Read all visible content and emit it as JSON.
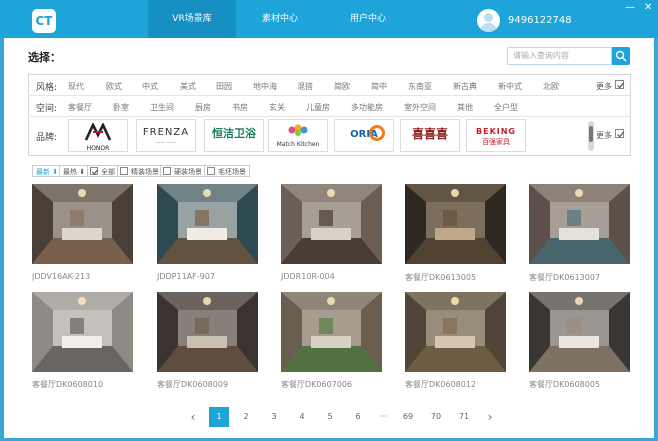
{
  "header": {
    "logo": "CT",
    "nav": [
      {
        "label": "VR场景库",
        "active": true
      },
      {
        "label": "素材中心",
        "active": false
      },
      {
        "label": "用户中心",
        "active": false
      }
    ],
    "phone": "9496122748",
    "window_controls": {
      "minimize": "—",
      "close": "✕"
    }
  },
  "selection": {
    "title": "选择：",
    "search_placeholder": "请输入查询内容",
    "more_label": "更多"
  },
  "filters": {
    "style": {
      "label": "风格:",
      "items": [
        "现代",
        "欧式",
        "中式",
        "美式",
        "田园",
        "地中海",
        "混搭",
        "简欧",
        "简中",
        "东南亚",
        "新古典",
        "新中式",
        "北欧"
      ]
    },
    "space": {
      "label": "空间:",
      "items": [
        "客餐厅",
        "卧室",
        "卫生间",
        "厨房",
        "书房",
        "玄关",
        "儿童房",
        "多功能房",
        "室外空间",
        "其他",
        "全户型"
      ]
    },
    "brand": {
      "label": "品牌:",
      "items": [
        {
          "name": "HONOR"
        },
        {
          "name": "FRENZA"
        },
        {
          "name": "恒洁卫浴"
        },
        {
          "name": "Match Kitchen"
        },
        {
          "name": "ORIA"
        },
        {
          "name": "喜喜喜"
        },
        {
          "name": "BEKING"
        }
      ]
    }
  },
  "toolbar": {
    "sort_latest": "最新 ⬇",
    "sort_hot": "最热 ⬇",
    "types": [
      {
        "label": "全部",
        "checked": true
      },
      {
        "label": "精装场景",
        "checked": false
      },
      {
        "label": "硬装场景",
        "checked": false
      },
      {
        "label": "毛坯场景",
        "checked": false
      }
    ]
  },
  "scenes": [
    {
      "title": "JDDV16AK-213",
      "palette": [
        "#4a4038",
        "#dcd6cc",
        "#8b6d55"
      ]
    },
    {
      "title": "JDDP11AF-907",
      "palette": [
        "#2d4a52",
        "#f0ebe4",
        "#7a5638"
      ]
    },
    {
      "title": "JDDR10R-004",
      "palette": [
        "#6b5f55",
        "#d9d2c8",
        "#3a2f28"
      ]
    },
    {
      "title": "客餐厅DK0613005",
      "palette": [
        "#2e2823",
        "#bfa88a",
        "#604b38"
      ]
    },
    {
      "title": "客餐厅DK0613007",
      "palette": [
        "#5c5048",
        "#e5e0d8",
        "#3f6e7a"
      ]
    },
    {
      "title": "客餐厅DK0608010",
      "palette": [
        "#8e8a85",
        "#f0eeea",
        "#5a5550"
      ]
    },
    {
      "title": "客餐厅DK0608009",
      "palette": [
        "#3a3330",
        "#c9c0b4",
        "#6e5a48"
      ]
    },
    {
      "title": "客餐厅DK0607006",
      "palette": [
        "#6a5e50",
        "#d8d0c2",
        "#4a7a3a"
      ]
    },
    {
      "title": "客餐厅DK0608012",
      "palette": [
        "#4f4538",
        "#d6c8b0",
        "#7e6848"
      ]
    },
    {
      "title": "客餐厅DK0608005",
      "palette": [
        "#3a3634",
        "#ebe6df",
        "#9a8a78"
      ]
    }
  ],
  "pagination": {
    "prev": "‹",
    "next": "›",
    "pages": [
      "1",
      "2",
      "3",
      "4",
      "5",
      "6",
      "···",
      "69",
      "70",
      "71"
    ],
    "current": "1"
  }
}
